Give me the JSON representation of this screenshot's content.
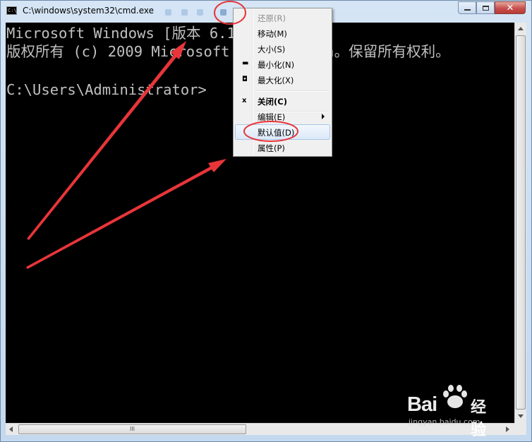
{
  "window": {
    "title": "C:\\windows\\system32\\cmd.exe",
    "icon": "cmd-icon",
    "icon_text": "C:\\",
    "close_glyph": "✕"
  },
  "console": {
    "lines": [
      "Microsoft Windows [版本 6.1",
      "版权所有 (c) 2009 Microsoft Corporation。保留所有权利。",
      "",
      "C:\\Users\\Administrator>"
    ]
  },
  "system_menu": {
    "items": [
      {
        "label": "还原(R)",
        "icon": "",
        "disabled": true
      },
      {
        "label": "移动(M)",
        "icon": ""
      },
      {
        "label": "大小(S)",
        "icon": ""
      },
      {
        "label": "最小化(N)",
        "icon": "minimize-icon"
      },
      {
        "label": "最大化(X)",
        "icon": "maximize-icon"
      },
      {
        "label": "关闭(C)",
        "icon": "close-icon",
        "bold": true
      },
      {
        "label": "编辑(E)",
        "icon": "",
        "submenu": true
      },
      {
        "label": "默认值(D)",
        "icon": "",
        "highlighted": true
      },
      {
        "label": "属性(P)",
        "icon": ""
      }
    ],
    "icon_glyphs": {
      "minimize": "▬",
      "maximize": "◘",
      "close": "x"
    }
  },
  "scrollbar": {
    "thumb_grip": "III"
  },
  "watermark": {
    "brand": "Bai",
    "brand_suffix": "经验",
    "url": "jingyan.baidu.com"
  },
  "colors": {
    "console_bg": "#000000",
    "console_text": "#c0c0c0",
    "annotation_red": "#e8353a",
    "menu_highlight": "#dce9f8"
  }
}
